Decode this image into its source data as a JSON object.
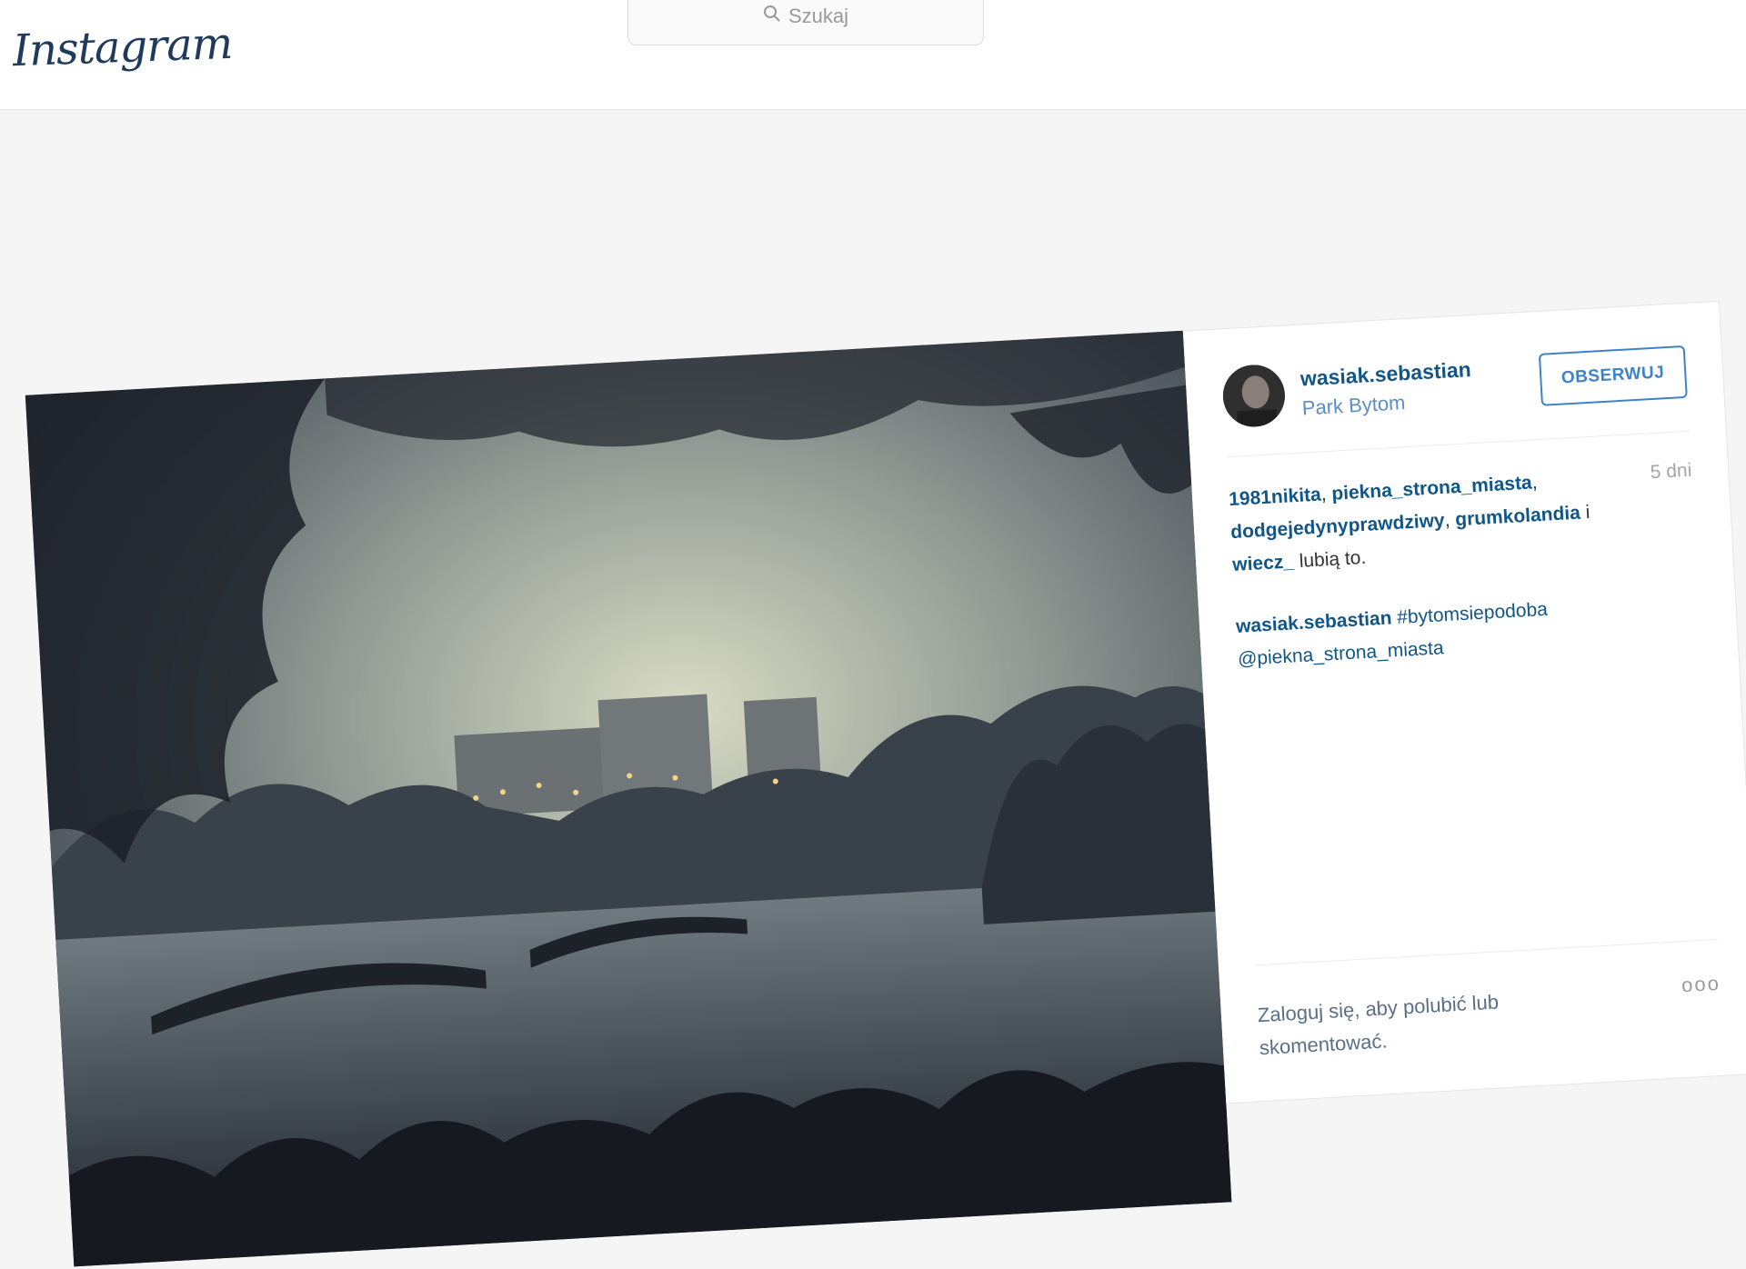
{
  "header": {
    "logo": "Instagram",
    "search_placeholder": "Szukaj",
    "search_icon": "search-icon"
  },
  "post": {
    "username": "wasiak.sebastian",
    "location": "Park Bytom",
    "follow_label": "OBSERWUJ",
    "time": "5 dni",
    "likes": {
      "users": [
        "1981nikita",
        "piekna_strona_miasta",
        "dodgejedynyprawdziwy",
        "grumkolandia"
      ],
      "sep1": ", ",
      "and_label": " i ",
      "last_user": "wiecz_",
      "suffix": " lubią to."
    },
    "caption": {
      "user": "wasiak.sebastian",
      "text": "#bytomsiepodoba @piekna_strona_miasta"
    },
    "login_prompt": "Zaloguj się, aby polubić lub skomentować.",
    "more_label": "ooo"
  },
  "colors": {
    "link": "#125688",
    "accent": "#3f82c6",
    "background": "#f5f5f6"
  }
}
